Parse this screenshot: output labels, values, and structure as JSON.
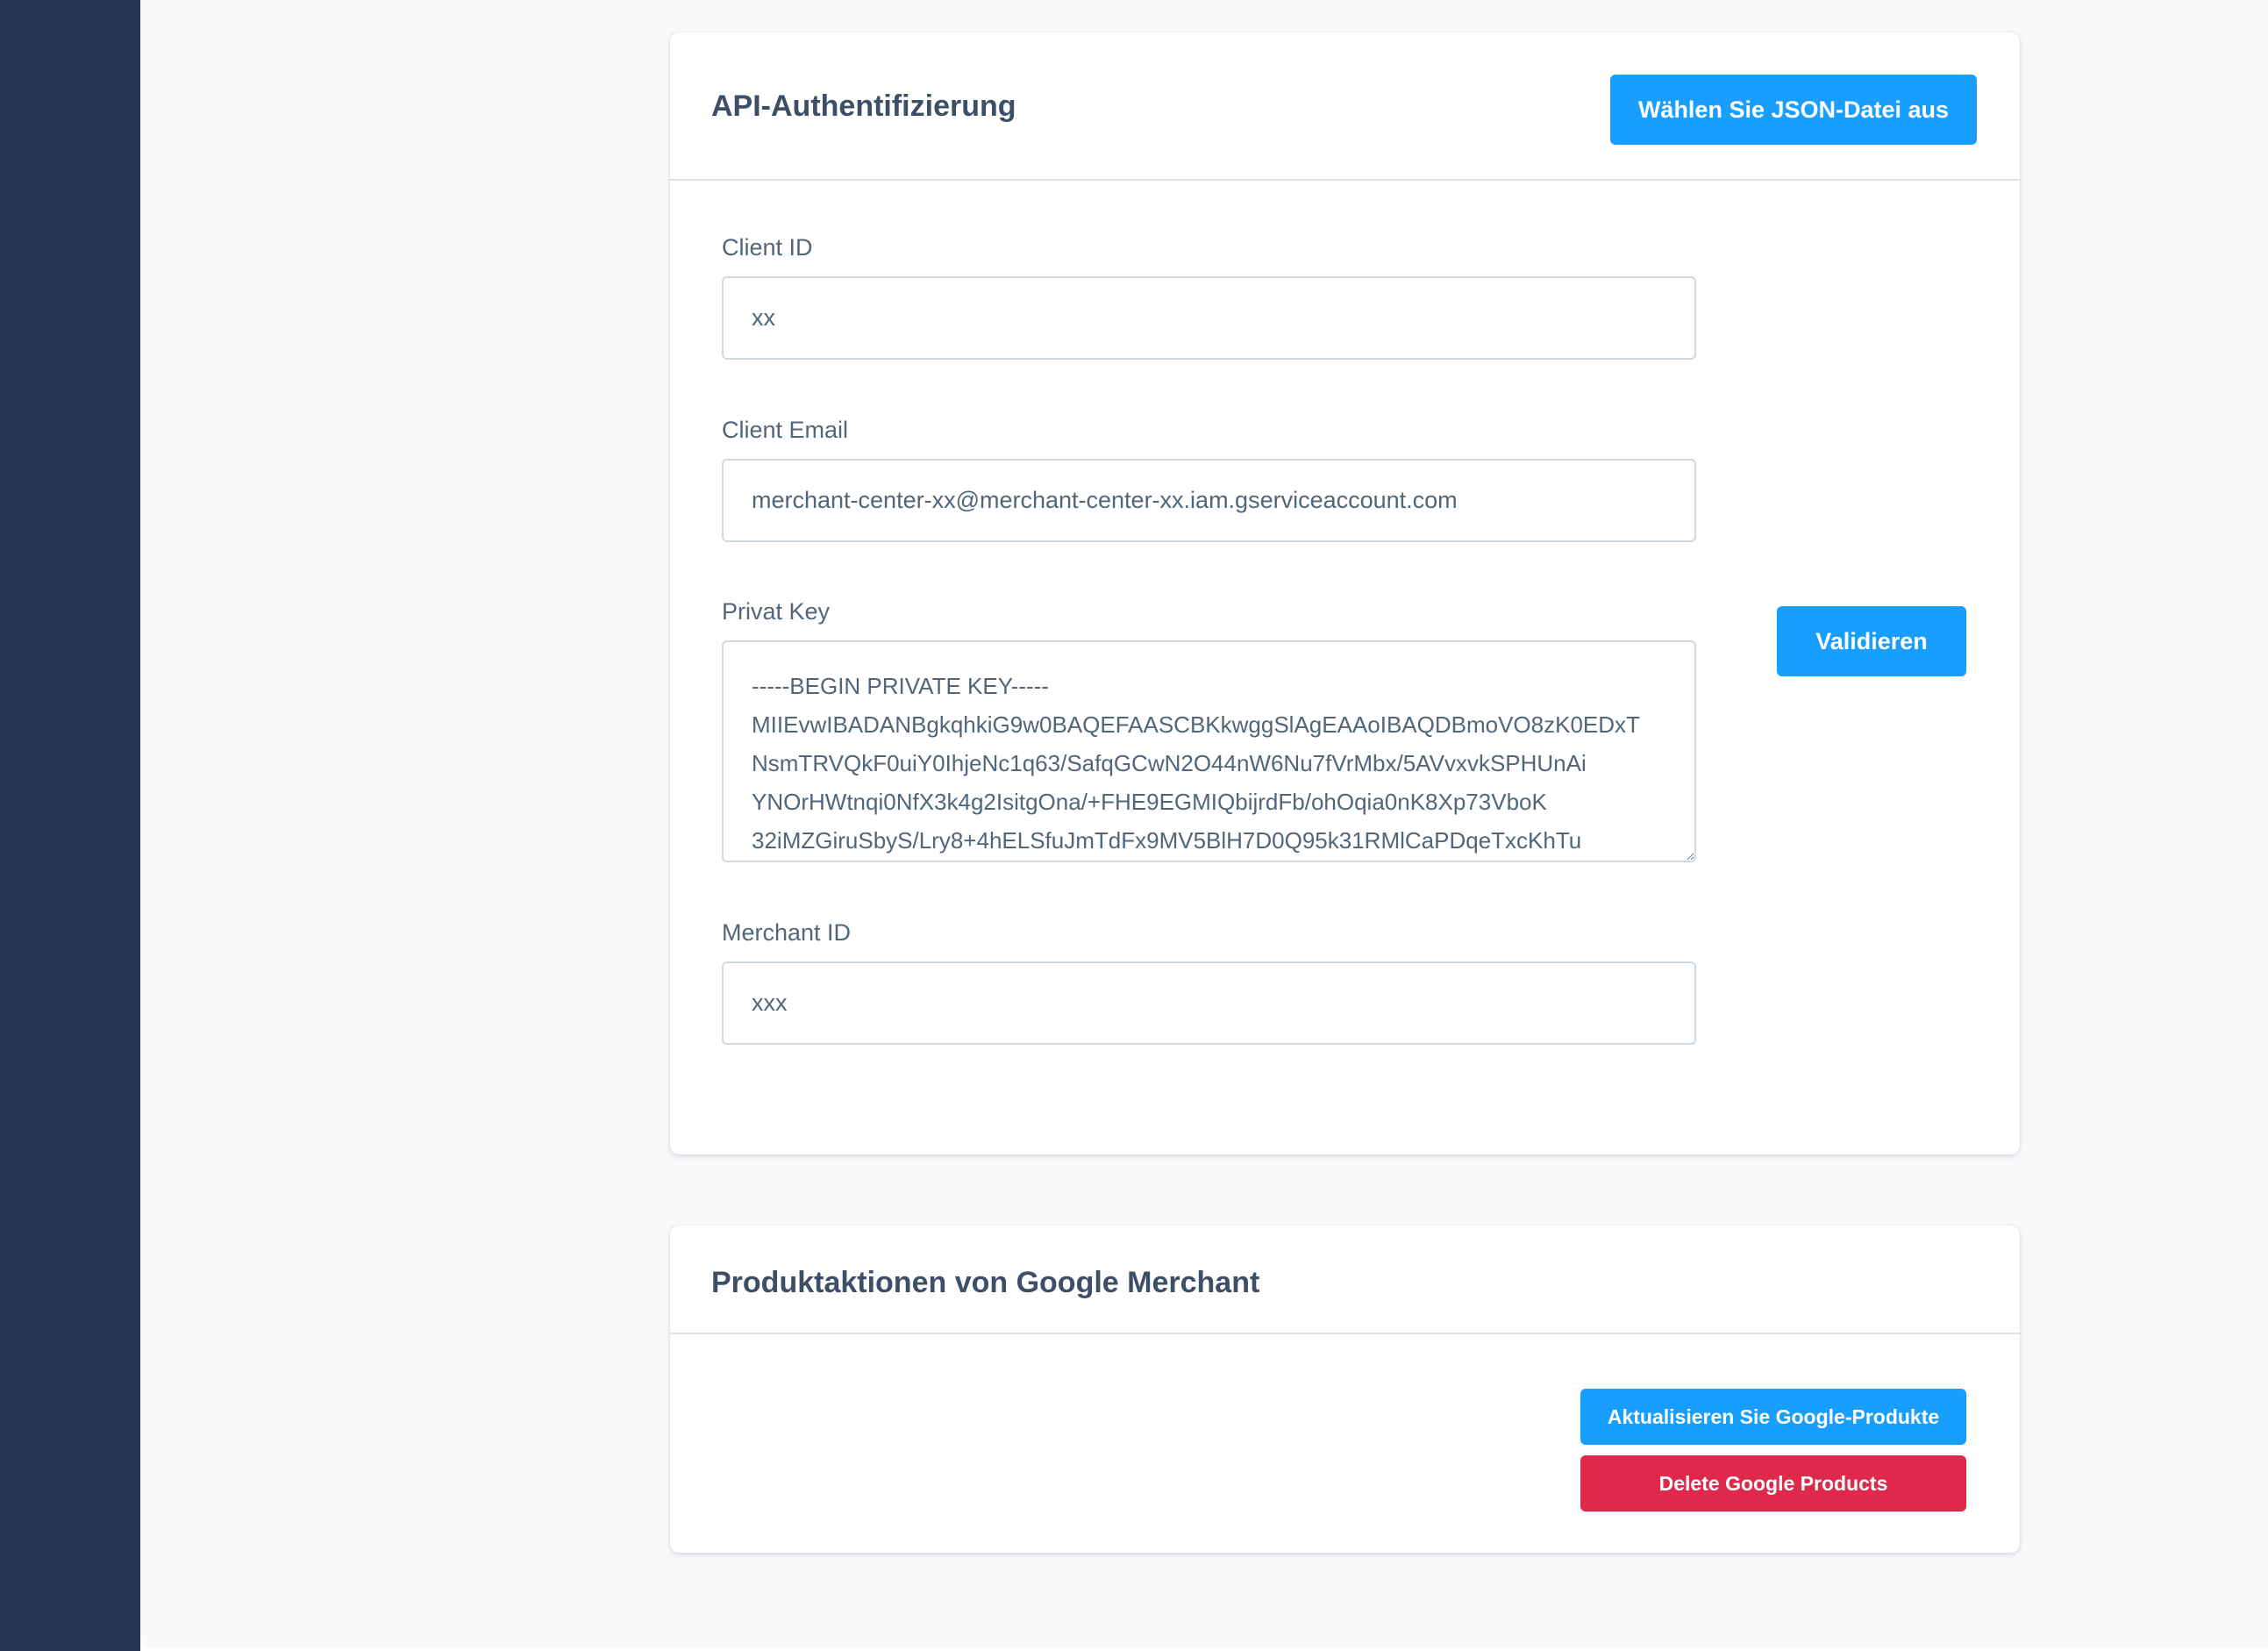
{
  "auth_card": {
    "title": "API-Authentifizierung",
    "json_button_label": "Wählen Sie JSON-Datei aus",
    "validate_button_label": "Validieren",
    "fields": {
      "client_id": {
        "label": "Client ID",
        "value": "xx"
      },
      "client_email": {
        "label": "Client Email",
        "value": "merchant-center-xx@merchant-center-xx.iam.gserviceaccount.com"
      },
      "private_key": {
        "label": "Privat Key",
        "value": "-----BEGIN PRIVATE KEY-----\nMIIEvwIBADANBgkqhkiG9w0BAQEFAASCBKkwggSlAgEAAoIBAQDBmoVO8zK0EDxT\nNsmTRVQkF0uiY0IhjeNc1q63/SafqGCwN2O44nW6Nu7fVrMbx/5AVvxvkSPHUnAi\nYNOrHWtnqi0NfX3k4g2IsitgOna/+FHE9EGMIQbijrdFb/ohOqia0nK8Xp73VboK\n32iMZGiruSbyS/Lry8+4hELSfuJmTdFx9MV5BlH7D0Q95k31RMlCaPDqeTxcKhTu"
      },
      "merchant_id": {
        "label": "Merchant ID",
        "value": "xxx"
      }
    }
  },
  "products_card": {
    "title": "Produktaktionen von Google Merchant",
    "update_button_label": "Aktualisieren Sie Google-Produkte",
    "delete_button_label": "Delete Google Products"
  },
  "colors": {
    "sidebar": "#243554",
    "background": "#f8f9fb",
    "primary": "#189eff",
    "danger": "#de294c",
    "text": "#52667a"
  }
}
